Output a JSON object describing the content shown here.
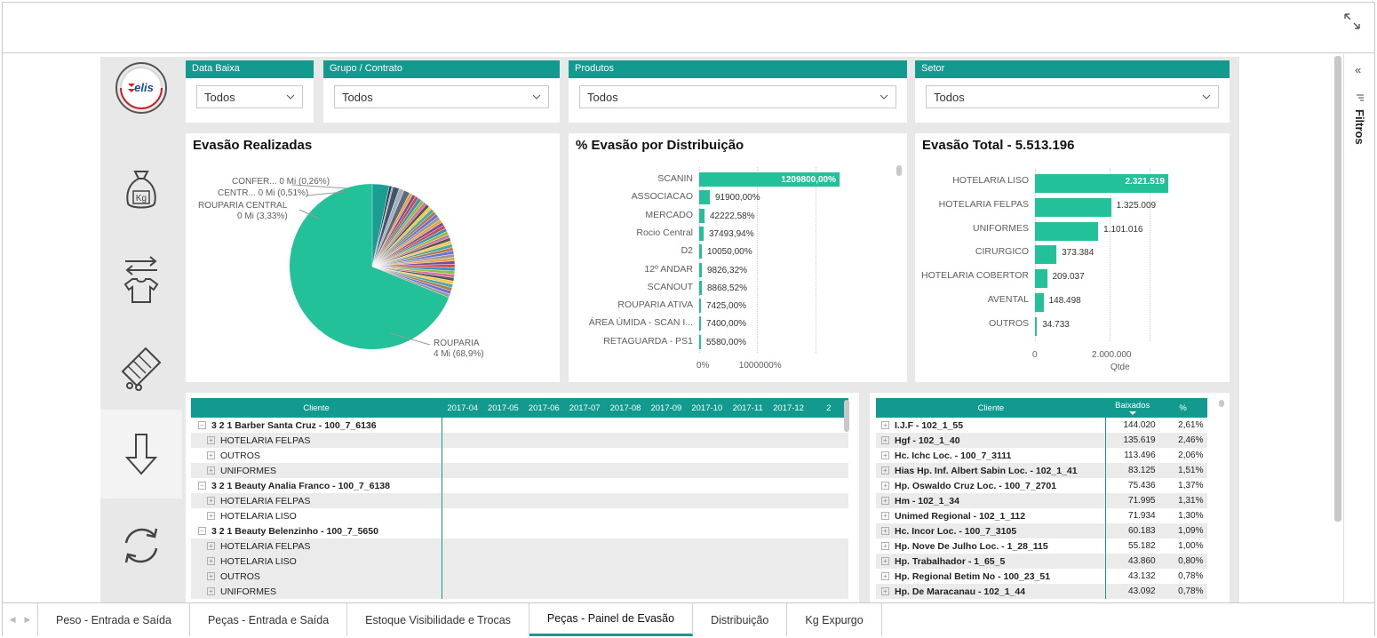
{
  "slicers": [
    {
      "label": "Data Baixa",
      "value": "Todos"
    },
    {
      "label": "Grupo / Contrato",
      "value": "Todos"
    },
    {
      "label": "Produtos",
      "value": "Todos"
    },
    {
      "label": "Setor",
      "value": "Todos"
    }
  ],
  "logo_text": "elis",
  "pie": {
    "title": "Evasão Realizadas",
    "labels": [
      {
        "name": "CONFER...",
        "value": "0 Mi (0,26%)"
      },
      {
        "name": "CENTR...",
        "value": "0 Mi (0,51%)"
      },
      {
        "name": "ROUPARIA CENTRAL",
        "value": "0 Mi (3,33%)"
      },
      {
        "name": "ROUPARIA",
        "value": "4 Mi (68,9%)"
      }
    ]
  },
  "dist": {
    "title": "% Evasão por Distribuição",
    "axis": [
      "0%",
      "1000000%"
    ],
    "rows": [
      {
        "name": "SCANIN",
        "value": 1209800.0,
        "label": "1209800,00%"
      },
      {
        "name": "ASSOCIACAO",
        "value": 91900.0,
        "label": "91900,00%"
      },
      {
        "name": "MERCADO",
        "value": 42222.58,
        "label": "42222,58%"
      },
      {
        "name": "Rocio Central",
        "value": 37493.94,
        "label": "37493,94%"
      },
      {
        "name": "D2",
        "value": 10050.0,
        "label": "10050,00%"
      },
      {
        "name": "12º ANDAR",
        "value": 9826.32,
        "label": "9826,32%"
      },
      {
        "name": "SCANOUT",
        "value": 8868.52,
        "label": "8868,52%"
      },
      {
        "name": "ROUPARIA ATIVA",
        "value": 7425.0,
        "label": "7425,00%"
      },
      {
        "name": "ÁREA ÚMIDA - SCAN I...",
        "value": 7400.0,
        "label": "7400,00%"
      },
      {
        "name": "RETAGUARDA - PS1",
        "value": 5580.0,
        "label": "5580,00%"
      }
    ]
  },
  "total": {
    "title": "Evasão Total - 5.513.196",
    "axis": [
      "0",
      "2.000.000"
    ],
    "xlabel": "Qtde",
    "rows": [
      {
        "name": "HOTELARIA LISO",
        "value": 2321519,
        "label": "2.321.519"
      },
      {
        "name": "HOTELARIA FELPAS",
        "value": 1325009,
        "label": "1.325.009"
      },
      {
        "name": "UNIFORMES",
        "value": 1101016,
        "label": "1.101.016"
      },
      {
        "name": "CIRURGICO",
        "value": 373384,
        "label": "373.384"
      },
      {
        "name": "HOTELARIA COBERTOR",
        "value": 209037,
        "label": "209.037"
      },
      {
        "name": "AVENTAL",
        "value": 148498,
        "label": "148.498"
      },
      {
        "name": "OUTROS",
        "value": 34733,
        "label": "34.733"
      }
    ]
  },
  "matrix": {
    "header": "Cliente",
    "months": [
      "2017-04",
      "2017-05",
      "2017-06",
      "2017-07",
      "2017-08",
      "2017-09",
      "2017-10",
      "2017-11",
      "2017-12",
      "2"
    ],
    "rows": [
      {
        "text": "3 2 1 Barber Santa Cruz - 100_7_6136",
        "level": 0,
        "sign": "−"
      },
      {
        "text": "HOTELARIA FELPAS",
        "level": 1,
        "sign": "+"
      },
      {
        "text": "OUTROS",
        "level": 1,
        "sign": "+"
      },
      {
        "text": "UNIFORMES",
        "level": 1,
        "sign": "+"
      },
      {
        "text": "3 2 1 Beauty Analia Franco - 100_7_6138",
        "level": 0,
        "sign": "−"
      },
      {
        "text": "HOTELARIA FELPAS",
        "level": 1,
        "sign": "+"
      },
      {
        "text": "HOTELARIA LISO",
        "level": 1,
        "sign": "+"
      },
      {
        "text": "3 2 1 Beauty Belenzinho - 100_7_5650",
        "level": 0,
        "sign": "−"
      },
      {
        "text": "HOTELARIA FELPAS",
        "level": 1,
        "sign": "+"
      },
      {
        "text": "HOTELARIA LISO",
        "level": 1,
        "sign": "+"
      },
      {
        "text": "OUTROS",
        "level": 1,
        "sign": "+"
      },
      {
        "text": "UNIFORMES",
        "level": 1,
        "sign": "+"
      }
    ]
  },
  "clients": {
    "headers": [
      "Cliente",
      "Baixados",
      "%"
    ],
    "rows": [
      {
        "name": "I.J.F - 102_1_55",
        "qty": "144.020",
        "pct": "2,61%"
      },
      {
        "name": "Hgf - 102_1_40",
        "qty": "135.619",
        "pct": "2,46%"
      },
      {
        "name": "Hc. Ichc Loc. - 100_7_3111",
        "qty": "113.496",
        "pct": "2,06%"
      },
      {
        "name": "Hias Hp. Inf. Albert Sabin Loc. - 102_1_41",
        "qty": "83.125",
        "pct": "1,51%"
      },
      {
        "name": "Hp. Oswaldo Cruz Loc. - 100_7_2701",
        "qty": "75.436",
        "pct": "1,37%"
      },
      {
        "name": "Hm - 102_1_34",
        "qty": "71.995",
        "pct": "1,31%"
      },
      {
        "name": "Unimed Regional - 102_1_112",
        "qty": "71.934",
        "pct": "1,30%"
      },
      {
        "name": "Hc. Incor Loc. - 100_7_3105",
        "qty": "60.183",
        "pct": "1,09%"
      },
      {
        "name": "Hp. Nove De Julho Loc. - 1_28_115",
        "qty": "55.182",
        "pct": "1,00%"
      },
      {
        "name": "Hp. Trabalhador - 1_65_5",
        "qty": "43.860",
        "pct": "0,80%"
      },
      {
        "name": "Hp. Regional Betim No - 100_23_51",
        "qty": "43.132",
        "pct": "0,78%"
      },
      {
        "name": "Hp. De Maracanau - 102_1_44",
        "qty": "43.092",
        "pct": "0,78%"
      }
    ]
  },
  "filters_label": "Filtros",
  "tabs": [
    "Peso - Entrada e Saída",
    "Peças - Entrada e Saída",
    "Estoque Visibilidade e Trocas",
    "Peças - Painel de Evasão",
    "Distribuição",
    "Kg Expurgo"
  ],
  "active_tab": "Peças - Painel de Evasão",
  "colors": {
    "accent": "#119a8d",
    "bar": "#22c19a",
    "pie_main": "#22c19a"
  }
}
